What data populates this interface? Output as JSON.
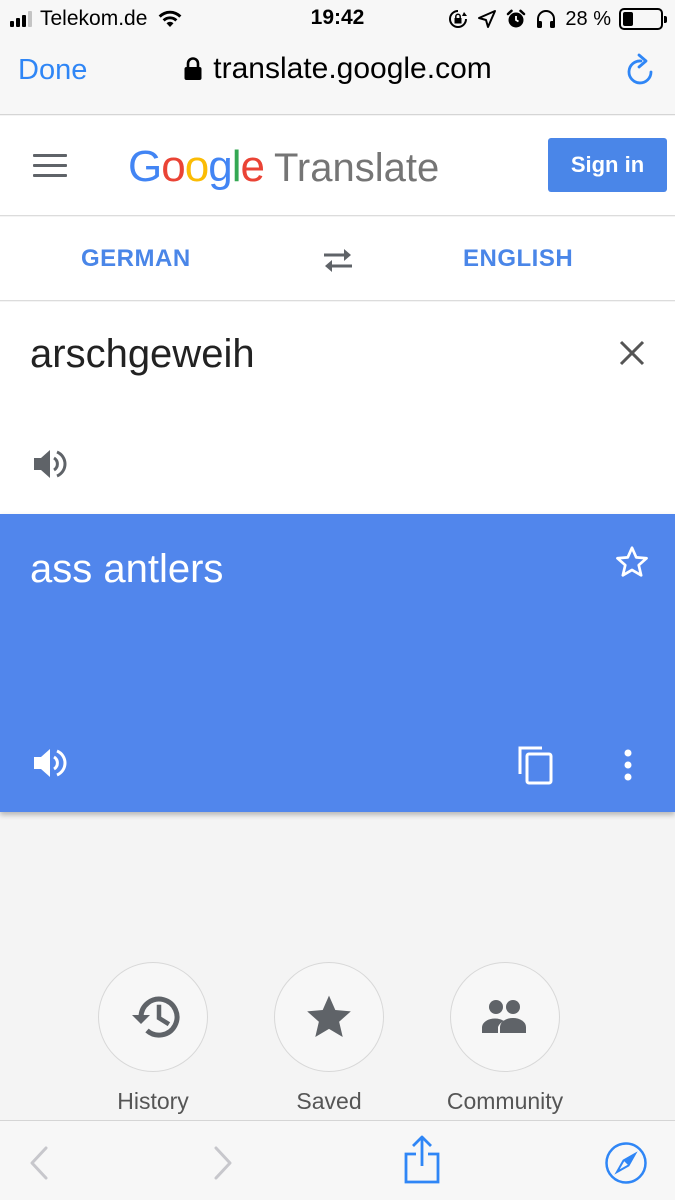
{
  "status_bar": {
    "carrier": "Telekom.de",
    "time": "19:42",
    "battery_percent": "28 %",
    "battery_level": 0.28,
    "icons": [
      "signal-icon",
      "wifi-icon",
      "screen-lock-icon",
      "location-icon",
      "alarm-icon",
      "headphones-icon",
      "battery-icon"
    ]
  },
  "browser": {
    "done_label": "Done",
    "url": "translate.google.com",
    "icons": [
      "lock-icon",
      "reload-icon"
    ]
  },
  "header": {
    "logo_letters": [
      "G",
      "o",
      "o",
      "g",
      "l",
      "e"
    ],
    "product": "Translate",
    "sign_in_label": "Sign in",
    "colors": {
      "blue": "#4285f4",
      "red": "#ea4335",
      "yellow": "#fbbc05",
      "green": "#34a853",
      "button": "#4a86e8"
    }
  },
  "languages": {
    "source": "GERMAN",
    "target": "ENGLISH",
    "swap_icon": "swap-icon"
  },
  "input": {
    "text": "arschgeweih",
    "icons": [
      "clear-icon",
      "speaker-icon"
    ]
  },
  "output": {
    "text": "ass antlers",
    "background": "#5186ec",
    "icons": [
      "star-icon",
      "speaker-icon",
      "copy-icon",
      "more-vert-icon"
    ]
  },
  "shortcuts": [
    {
      "label": "History",
      "icon": "history-icon"
    },
    {
      "label": "Saved",
      "icon": "star-filled-icon"
    },
    {
      "label": "Community",
      "icon": "people-icon"
    }
  ],
  "toolbar": {
    "icons": [
      "back-icon",
      "forward-icon",
      "share-icon",
      "safari-compass-icon"
    ]
  }
}
